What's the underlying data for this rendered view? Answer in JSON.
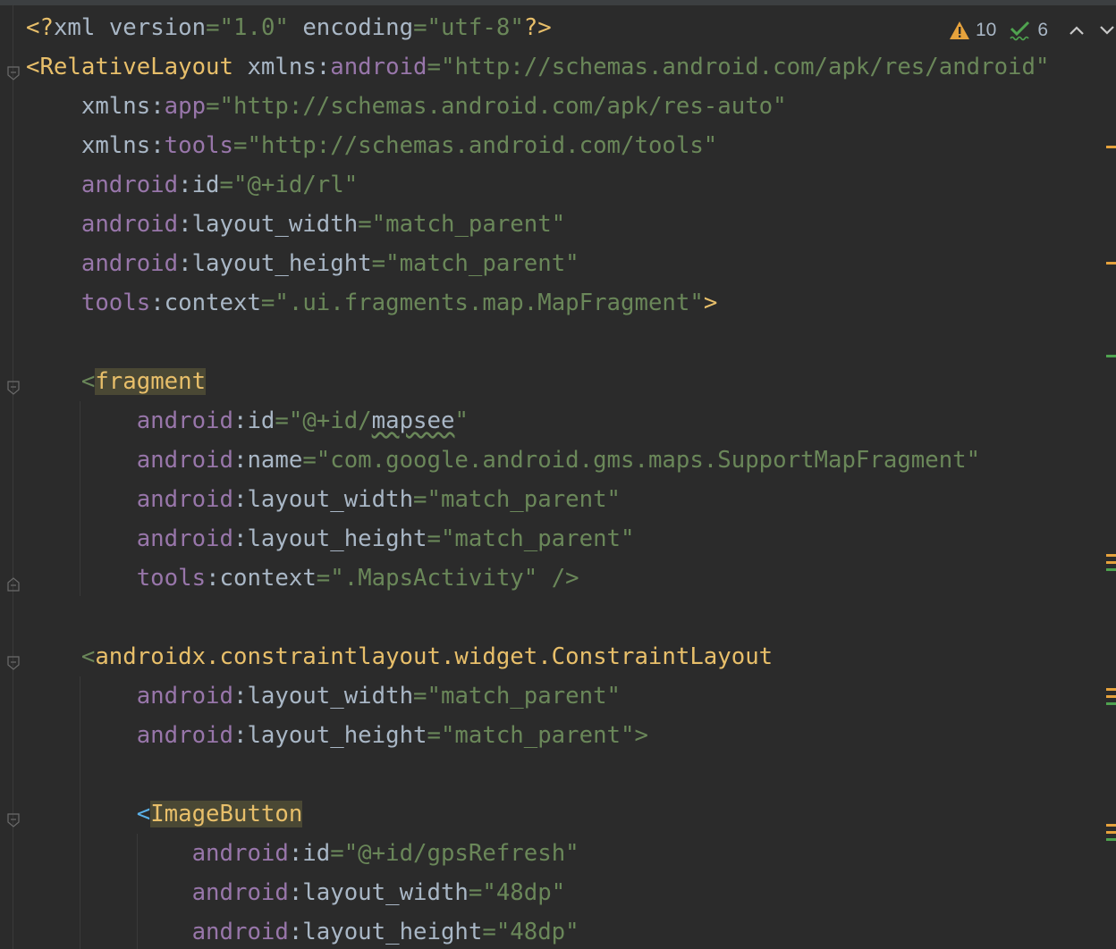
{
  "editor": {
    "lines": [
      [
        [
          "punc",
          "<?"
        ],
        [
          "plain",
          "xml "
        ],
        [
          "plain",
          "version"
        ],
        [
          "str",
          "=\"1.0\""
        ],
        [
          "plain",
          " encoding"
        ],
        [
          "str",
          "=\"utf-8\""
        ],
        [
          "punc",
          "?>"
        ]
      ],
      [
        [
          "tag",
          "<RelativeLayout "
        ],
        [
          "plain",
          "xmlns"
        ],
        [
          "plain",
          ":"
        ],
        [
          "ns",
          "android"
        ],
        [
          "str",
          "=\"http://schemas.android.com/apk/res/android\""
        ]
      ],
      [
        [
          "plain",
          "    xmlns"
        ],
        [
          "plain",
          ":"
        ],
        [
          "ns",
          "app"
        ],
        [
          "str",
          "=\"http://schemas.android.com/apk/res-auto\""
        ]
      ],
      [
        [
          "plain",
          "    xmlns"
        ],
        [
          "plain",
          ":"
        ],
        [
          "ns",
          "tools"
        ],
        [
          "str",
          "=\"http://schemas.android.com/tools\""
        ]
      ],
      [
        [
          "ns",
          "    android"
        ],
        [
          "plain",
          ":id"
        ],
        [
          "str",
          "=\"@+id/rl\""
        ]
      ],
      [
        [
          "ns",
          "    android"
        ],
        [
          "plain",
          ":layout_width"
        ],
        [
          "str",
          "=\"match_parent\""
        ]
      ],
      [
        [
          "ns",
          "    android"
        ],
        [
          "plain",
          ":layout_height"
        ],
        [
          "str",
          "=\"match_parent\""
        ]
      ],
      [
        [
          "ns",
          "    tools"
        ],
        [
          "plain",
          ":context"
        ],
        [
          "str",
          "=\".ui.fragments.map.MapFragment\""
        ],
        [
          "tag",
          ">"
        ]
      ],
      [
        [
          "plain",
          ""
        ]
      ],
      [
        [
          "lt-green",
          "    <"
        ],
        [
          "tag-hl",
          "fragment"
        ]
      ],
      [
        [
          "ns",
          "        android"
        ],
        [
          "plain",
          ":id"
        ],
        [
          "str",
          "=\"@+id/"
        ],
        [
          "squiggle",
          "mapsee"
        ],
        [
          "str",
          "\""
        ]
      ],
      [
        [
          "ns",
          "        android"
        ],
        [
          "plain",
          ":name"
        ],
        [
          "str",
          "=\"com.google.android.gms.maps.SupportMapFragment\""
        ]
      ],
      [
        [
          "ns",
          "        android"
        ],
        [
          "plain",
          ":layout_width"
        ],
        [
          "str",
          "=\"match_parent\""
        ]
      ],
      [
        [
          "ns",
          "        android"
        ],
        [
          "plain",
          ":layout_height"
        ],
        [
          "str",
          "=\"match_parent\""
        ]
      ],
      [
        [
          "ns",
          "        tools"
        ],
        [
          "plain",
          ":context"
        ],
        [
          "str",
          "=\".MapsActivity\""
        ],
        [
          "lt-green",
          " />"
        ]
      ],
      [
        [
          "plain",
          ""
        ]
      ],
      [
        [
          "lt-green",
          "    <"
        ],
        [
          "tag",
          "androidx.constraintlayout.widget.ConstraintLayout"
        ]
      ],
      [
        [
          "ns",
          "        android"
        ],
        [
          "plain",
          ":layout_width"
        ],
        [
          "str",
          "=\"match_parent\""
        ]
      ],
      [
        [
          "ns",
          "        android"
        ],
        [
          "plain",
          ":layout_height"
        ],
        [
          "str",
          "=\"match_parent\""
        ],
        [
          "lt-green",
          ">"
        ]
      ],
      [
        [
          "plain",
          ""
        ]
      ],
      [
        [
          "lt-blue",
          "        <"
        ],
        [
          "tag-hl",
          "ImageButton"
        ]
      ],
      [
        [
          "ns",
          "            android"
        ],
        [
          "plain",
          ":id"
        ],
        [
          "str",
          "=\"@+id/gpsRefresh\""
        ]
      ],
      [
        [
          "ns",
          "            android"
        ],
        [
          "plain",
          ":layout_width"
        ],
        [
          "str",
          "=\"48dp\""
        ]
      ],
      [
        [
          "ns",
          "            android"
        ],
        [
          "plain",
          ":layout_height"
        ],
        [
          "str",
          "=\"48dp\""
        ]
      ]
    ]
  },
  "inspections": {
    "warnings_count": "10",
    "typos_count": "6",
    "warning_icon": "warning-triangle-icon",
    "typo_icon": "check-squiggle-icon",
    "up_icon": "chevron-up-icon",
    "down_icon": "chevron-down-icon",
    "warning_color": "#e6a23c",
    "typo_color": "#4fa34f"
  }
}
